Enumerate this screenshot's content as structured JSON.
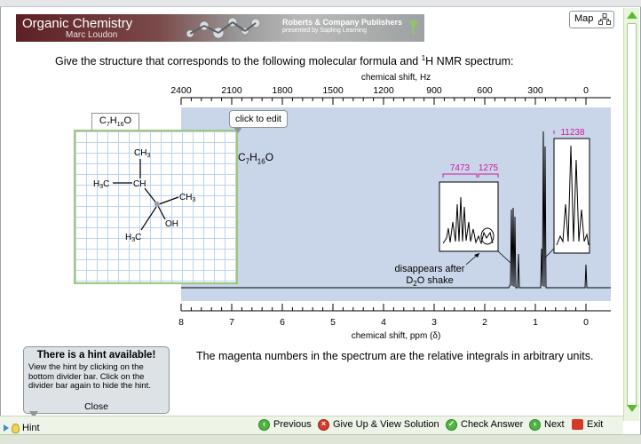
{
  "header": {
    "course_title": "Organic Chemistry",
    "author": "Marc Loudon",
    "publisher_line1": "Roberts & Company Publishers",
    "publisher_line2": "presented by Sapling Learning",
    "map_label": "Map"
  },
  "question": {
    "text_prefix": "Give the structure that corresponds to the following molecular formula and ",
    "superscript": "1",
    "text_suffix": "H NMR spectrum:"
  },
  "spectrum": {
    "top_axis_title": "chemical shift, Hz",
    "hz_ticks": [
      "2400",
      "2100",
      "1800",
      "1500",
      "1200",
      "900",
      "600",
      "300",
      "0"
    ],
    "bottom_axis_title": "chemical shift, ppm (δ)",
    "ppm_ticks": [
      "8",
      "7",
      "6",
      "5",
      "4",
      "3",
      "2",
      "1",
      "0"
    ],
    "integral_left": "7473",
    "integral_mid": "1275",
    "integral_right": "11238",
    "annotation_line1": "disappears after",
    "annotation_line2_prefix": "D",
    "annotation_line2_sub": "2",
    "annotation_line2_suffix": "O shake",
    "colors": {
      "plot_bg": "#c9d6ea",
      "integral": "#d2189c"
    }
  },
  "chart_data": {
    "type": "line",
    "title": "",
    "xlabel": "chemical shift, ppm (δ)",
    "x2label": "chemical shift, Hz",
    "xlim": [
      8,
      0
    ],
    "x2lim": [
      2400,
      0
    ],
    "peaks": [
      {
        "shift_ppm": 1.5,
        "integral": 7473
      },
      {
        "shift_ppm": 1.35,
        "integral": 1275
      },
      {
        "shift_ppm": 0.88,
        "integral": 11238
      },
      {
        "shift_ppm": 0.0,
        "integral": null
      }
    ],
    "annotations": [
      "disappears after D2O shake"
    ]
  },
  "structure": {
    "tab_prefix": "C",
    "tab_sub1": "7",
    "tab_mid": "H",
    "tab_sub2": "16",
    "tab_suffix": "O",
    "click_to_edit": "click to edit",
    "formula_prefix": "C",
    "formula_sub1": "7",
    "formula_mid": "H",
    "formula_sub2": "16",
    "formula_suffix": "O",
    "atoms": {
      "ch3_top": "CH",
      "ch3_top_sub": "3",
      "h3c_left": "H",
      "h3c_left_sub": "3",
      "h3c_left_c": "C",
      "ch": "CH",
      "ch3_right": "CH",
      "ch3_right_sub": "3",
      "oh": "OH",
      "h3c_bottom": "H",
      "h3c_bottom_sub": "3",
      "h3c_bottom_c": "C"
    }
  },
  "note": "The magenta numbers in the spectrum are the relative integrals in arbitrary units.",
  "hint": {
    "title": "There is a hint available!",
    "body": "View the hint by clicking on the bottom divider bar. Click on the divider bar again to hide the hint.",
    "close": "Close",
    "toggle_label": "Hint"
  },
  "nav": {
    "previous": "Previous",
    "give_up": "Give Up & View Solution",
    "check": "Check Answer",
    "next": "Next",
    "exit": "Exit"
  }
}
